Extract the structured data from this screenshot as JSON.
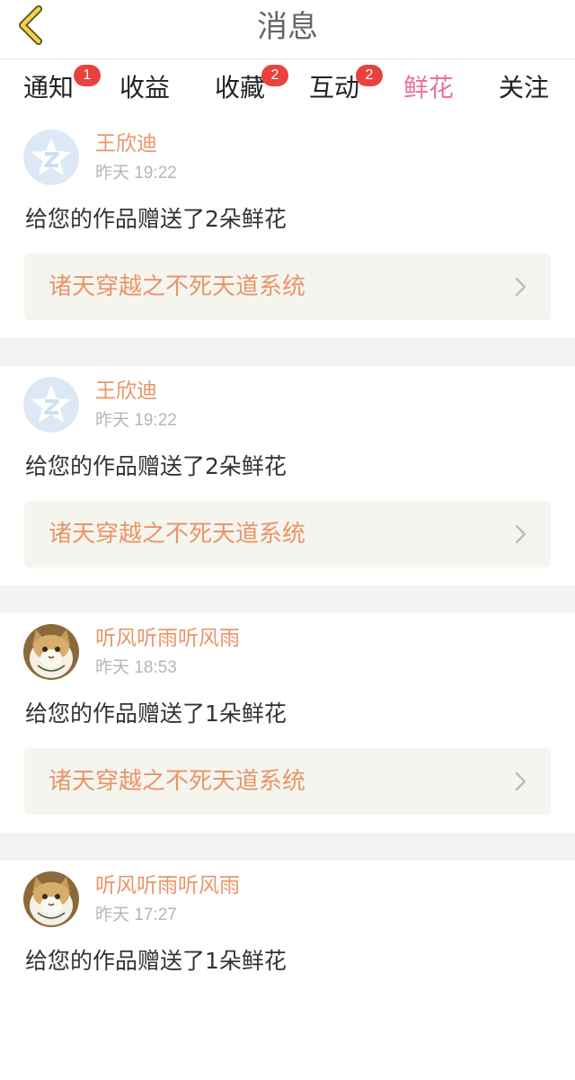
{
  "header": {
    "title": "消息",
    "back_icon": "chevron-left-icon"
  },
  "tabs": [
    {
      "label": "通知",
      "badge": "1",
      "active": false
    },
    {
      "label": "收益",
      "badge": "",
      "active": false
    },
    {
      "label": "收藏",
      "badge": "2",
      "active": false
    },
    {
      "label": "互动",
      "badge": "2",
      "active": false
    },
    {
      "label": "鲜花",
      "badge": "",
      "active": true
    },
    {
      "label": "关注",
      "badge": "",
      "active": false
    }
  ],
  "messages": [
    {
      "name": "王欣迪",
      "time": "昨天 19:22",
      "text": "给您的作品赠送了2朵鲜花",
      "work": "诸天穿越之不死天道系统",
      "avatar": "qzone-star-avatar"
    },
    {
      "name": "王欣迪",
      "time": "昨天 19:22",
      "text": "给您的作品赠送了2朵鲜花",
      "work": "诸天穿越之不死天道系统",
      "avatar": "qzone-star-avatar"
    },
    {
      "name": "听风听雨听风雨",
      "time": "昨天 18:53",
      "text": "给您的作品赠送了1朵鲜花",
      "work": "诸天穿越之不死天道系统",
      "avatar": "cat-photo-avatar"
    },
    {
      "name": "听风听雨听风雨",
      "time": "昨天 17:27",
      "text": "给您的作品赠送了1朵鲜花",
      "work": "",
      "avatar": "cat-photo-avatar"
    }
  ],
  "colors": {
    "accent": "#e8719a",
    "badge": "#e8423e",
    "name": "#e99569",
    "card_bg": "#f5f5ef"
  }
}
